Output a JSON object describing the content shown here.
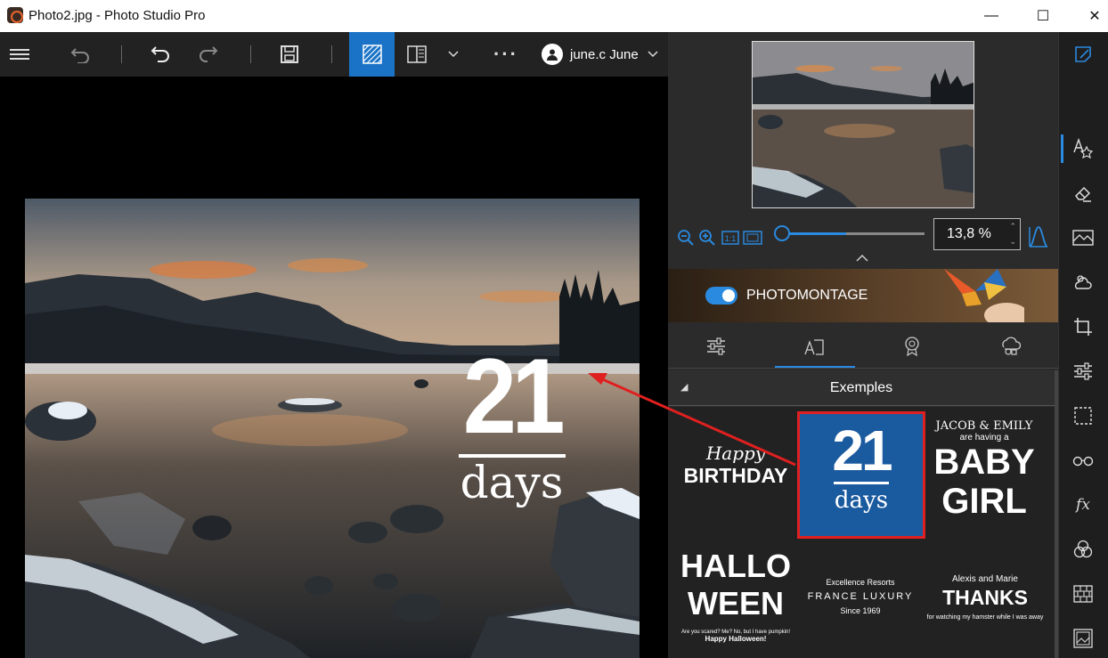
{
  "window": {
    "title": "Photo2.jpg - Photo Studio Pro",
    "minimize": "—",
    "maximize": "☐",
    "close": "✕"
  },
  "toolbar": {
    "more": "···",
    "user_name": "june.c June"
  },
  "overlay": {
    "number": "21",
    "word": "days"
  },
  "zoom": {
    "value": "13,8 %",
    "level_fraction": 0.0
  },
  "photomontage": {
    "label": "PHOTOMONTAGE",
    "enabled": true
  },
  "exemples": {
    "title": "Exemples",
    "tiles": {
      "birthday": {
        "line1": "Happy",
        "line2": "BIRTHDAY"
      },
      "days21": {
        "number": "21",
        "word": "days"
      },
      "baby": {
        "line1": "JACOB & EMILY",
        "line2": "are having a",
        "line3": "BABY",
        "line4": "GIRL"
      },
      "halloween": {
        "line1": "HALLO",
        "line2": "WEEN",
        "line3": "Are you scared? Me? No, but I have pumpkin!",
        "line4": "Happy Halloween!"
      },
      "luxury": {
        "line1": "Excellence Resorts",
        "line2": "FRANCE LUXURY",
        "line3": "Since 1969"
      },
      "thanks": {
        "line1": "Alexis and Marie",
        "line2": "THANKS",
        "line3": "for watching my hamster while I was away"
      }
    }
  },
  "colors": {
    "accent": "#1a73c7",
    "highlight_border": "#e02020",
    "tile_selected_bg": "#1a5a9e"
  },
  "icons": {
    "menu": "hamburger-icon",
    "undo_history": "undo-history-icon",
    "undo": "undo-icon",
    "redo": "redo-icon",
    "save": "save-icon",
    "view_single": "view-single-icon",
    "view_compare": "view-compare-icon",
    "dropdown": "chevron-down-icon",
    "user": "user-icon"
  }
}
